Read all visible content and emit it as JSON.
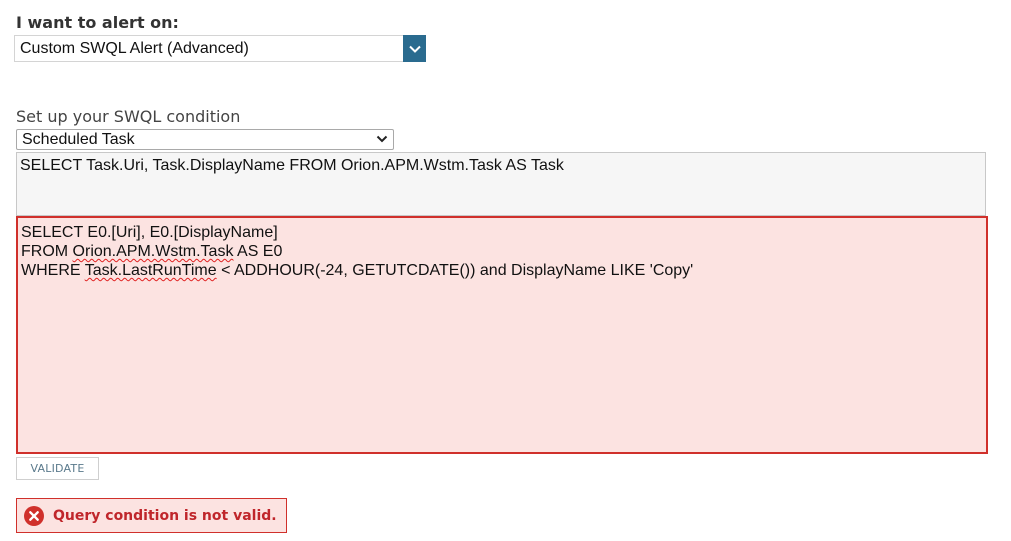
{
  "alert": {
    "label": "I want to alert on:",
    "selected": "Custom SWQL Alert (Advanced)"
  },
  "condition": {
    "label": "Set up your SWQL condition",
    "entity_selected": "Scheduled Task",
    "base_query": "SELECT Task.Uri, Task.DisplayName FROM Orion.APM.Wstm.Task AS Task",
    "editor": {
      "line1": "SELECT E0.[Uri], E0.[DisplayName]",
      "line2_pre": "FROM ",
      "line2_err": "Orion.APM.Wstm.Task",
      "line2_post": " AS E0",
      "line3_pre": "WHERE ",
      "line3_err": "Task.LastRunTime",
      "line3_post": " < ADDHOUR(-24, GETUTCDATE()) and DisplayName LIKE 'Copy'"
    }
  },
  "validate_label": "VALIDATE",
  "error_message": "Query condition is not valid.",
  "colors": {
    "dropdown_button": "#2a6b8f",
    "error": "#d0302b",
    "error_bg": "#fce3e1"
  },
  "icons": {
    "alert_dropdown": "chevron-down-icon",
    "entity_dropdown": "chevron-down-icon",
    "error": "error-x-icon"
  }
}
